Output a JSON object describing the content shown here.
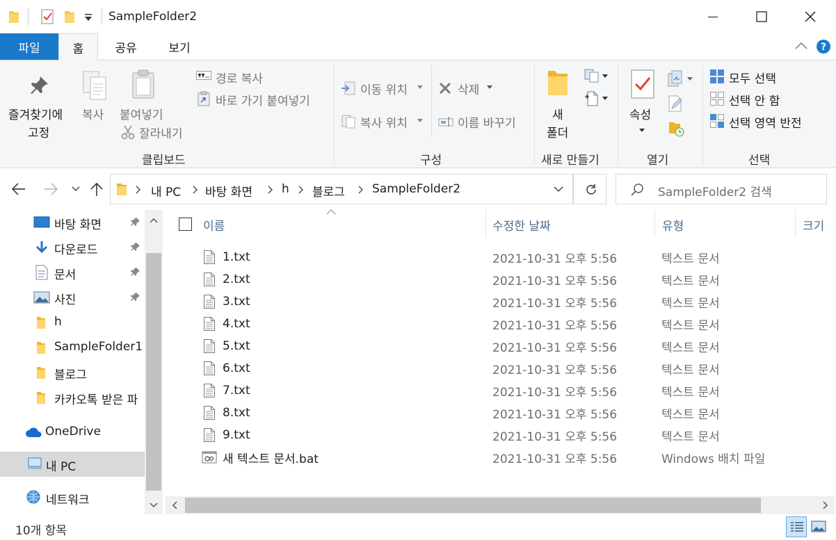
{
  "window": {
    "title": "SampleFolder2",
    "controls": {
      "minimize": "minimize",
      "maximize": "maximize",
      "close": "close"
    }
  },
  "tabs": [
    "파일",
    "홈",
    "공유",
    "보기"
  ],
  "ribbon": {
    "clipboard": {
      "pin_line1": "즐겨찾기에",
      "pin_line2": "고정",
      "copy": "복사",
      "paste": "붙여넣기",
      "copy_path": "경로 복사",
      "paste_shortcut": "바로 가기 붙여넣기",
      "cut": "잘라내기",
      "label": "클립보드"
    },
    "organize": {
      "move_to": "이동 위치",
      "copy_to": "복사 위치",
      "delete": "삭제",
      "rename": "이름 바꾸기",
      "label": "구성"
    },
    "new": {
      "new_folder_line1": "새",
      "new_folder_line2": "폴더",
      "label": "새로 만들기"
    },
    "open": {
      "properties": "속성",
      "label": "열기"
    },
    "select": {
      "select_all": "모두 선택",
      "select_none": "선택 안 함",
      "invert": "선택 영역 반전",
      "label": "선택"
    }
  },
  "address": {
    "breadcrumb": [
      "내 PC",
      "바탕 화면",
      "h",
      "블로그",
      "SampleFolder2"
    ],
    "search_placeholder": "SampleFolder2 검색"
  },
  "nav": [
    {
      "label": "바탕 화면",
      "icon": "desktop-icon",
      "pinned": true
    },
    {
      "label": "다운로드",
      "icon": "download-icon",
      "pinned": true
    },
    {
      "label": "문서",
      "icon": "document-icon",
      "pinned": true
    },
    {
      "label": "사진",
      "icon": "pictures-icon",
      "pinned": true
    },
    {
      "label": "h",
      "icon": "folder-icon",
      "pinned": false
    },
    {
      "label": "SampleFolder1",
      "icon": "folder-icon",
      "pinned": false
    },
    {
      "label": "블로그",
      "icon": "folder-icon",
      "pinned": false
    },
    {
      "label": "카카오톡 받은 파",
      "icon": "folder-icon",
      "pinned": false
    },
    {
      "label": "OneDrive",
      "icon": "onedrive-icon",
      "pinned": false
    },
    {
      "label": "내 PC",
      "icon": "pc-icon",
      "pinned": false
    },
    {
      "label": "네트워크",
      "icon": "network-icon",
      "pinned": false
    }
  ],
  "columns": {
    "name": "이름",
    "modified": "수정한 날짜",
    "type": "유형",
    "size": "크기"
  },
  "files": [
    {
      "name": "1.txt",
      "modified": "2021-10-31 오후 5:56",
      "type": "텍스트 문서",
      "icon": "text-file-icon"
    },
    {
      "name": "2.txt",
      "modified": "2021-10-31 오후 5:56",
      "type": "텍스트 문서",
      "icon": "text-file-icon"
    },
    {
      "name": "3.txt",
      "modified": "2021-10-31 오후 5:56",
      "type": "텍스트 문서",
      "icon": "text-file-icon"
    },
    {
      "name": "4.txt",
      "modified": "2021-10-31 오후 5:56",
      "type": "텍스트 문서",
      "icon": "text-file-icon"
    },
    {
      "name": "5.txt",
      "modified": "2021-10-31 오후 5:56",
      "type": "텍스트 문서",
      "icon": "text-file-icon"
    },
    {
      "name": "6.txt",
      "modified": "2021-10-31 오후 5:56",
      "type": "텍스트 문서",
      "icon": "text-file-icon"
    },
    {
      "name": "7.txt",
      "modified": "2021-10-31 오후 5:56",
      "type": "텍스트 문서",
      "icon": "text-file-icon"
    },
    {
      "name": "8.txt",
      "modified": "2021-10-31 오후 5:56",
      "type": "텍스트 문서",
      "icon": "text-file-icon"
    },
    {
      "name": "9.txt",
      "modified": "2021-10-31 오후 5:56",
      "type": "텍스트 문서",
      "icon": "text-file-icon"
    },
    {
      "name": "새 텍스트 문서.bat",
      "modified": "2021-10-31 오후 5:56",
      "type": "Windows 배치 파일",
      "icon": "batch-file-icon"
    }
  ],
  "status": {
    "item_count": "10개 항목"
  },
  "colors": {
    "accent": "#1979ca",
    "folder": "#f8c849",
    "header_text": "#4c6a8b"
  }
}
